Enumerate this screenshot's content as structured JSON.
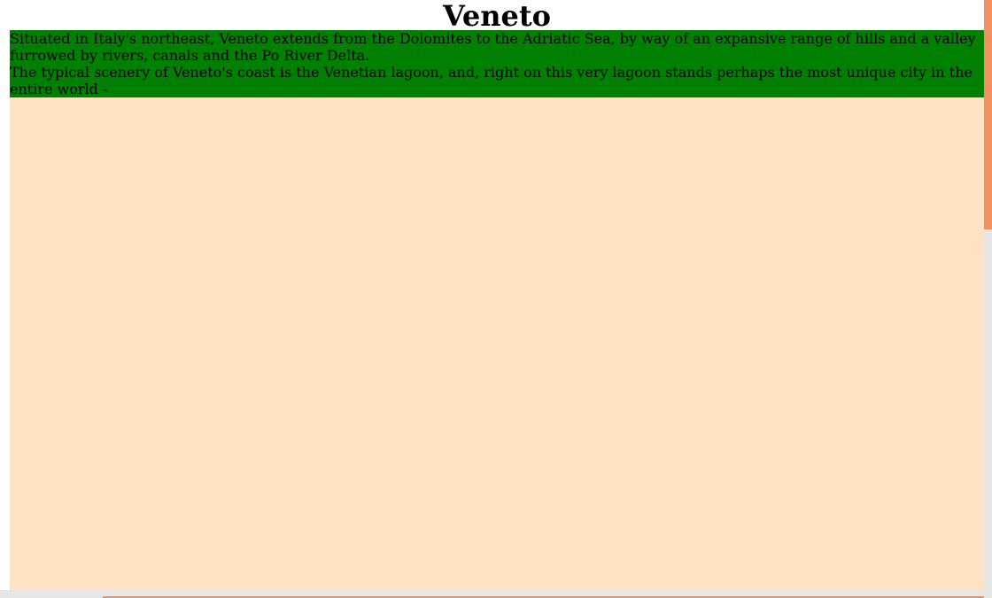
{
  "page": {
    "title": "Veneto",
    "paragraphs": [
      "Situated in Italy's northeast, Veneto extends from the Dolomites to the Adriatic Sea, by way of an expansive range of hills and a valley furrowed by rivers, canals and the Po River Delta.",
      "The typical scenery of Veneto's coast is the Venetian lagoon, and, right on this very lagoon stands perhaps the most unique city in the entire world -"
    ]
  },
  "colors": {
    "intro_background": "#008000",
    "content_background": "#fde3c3",
    "scrollbar_thumb": "#f0915f",
    "scrollbar_track": "#e6e6e6"
  }
}
